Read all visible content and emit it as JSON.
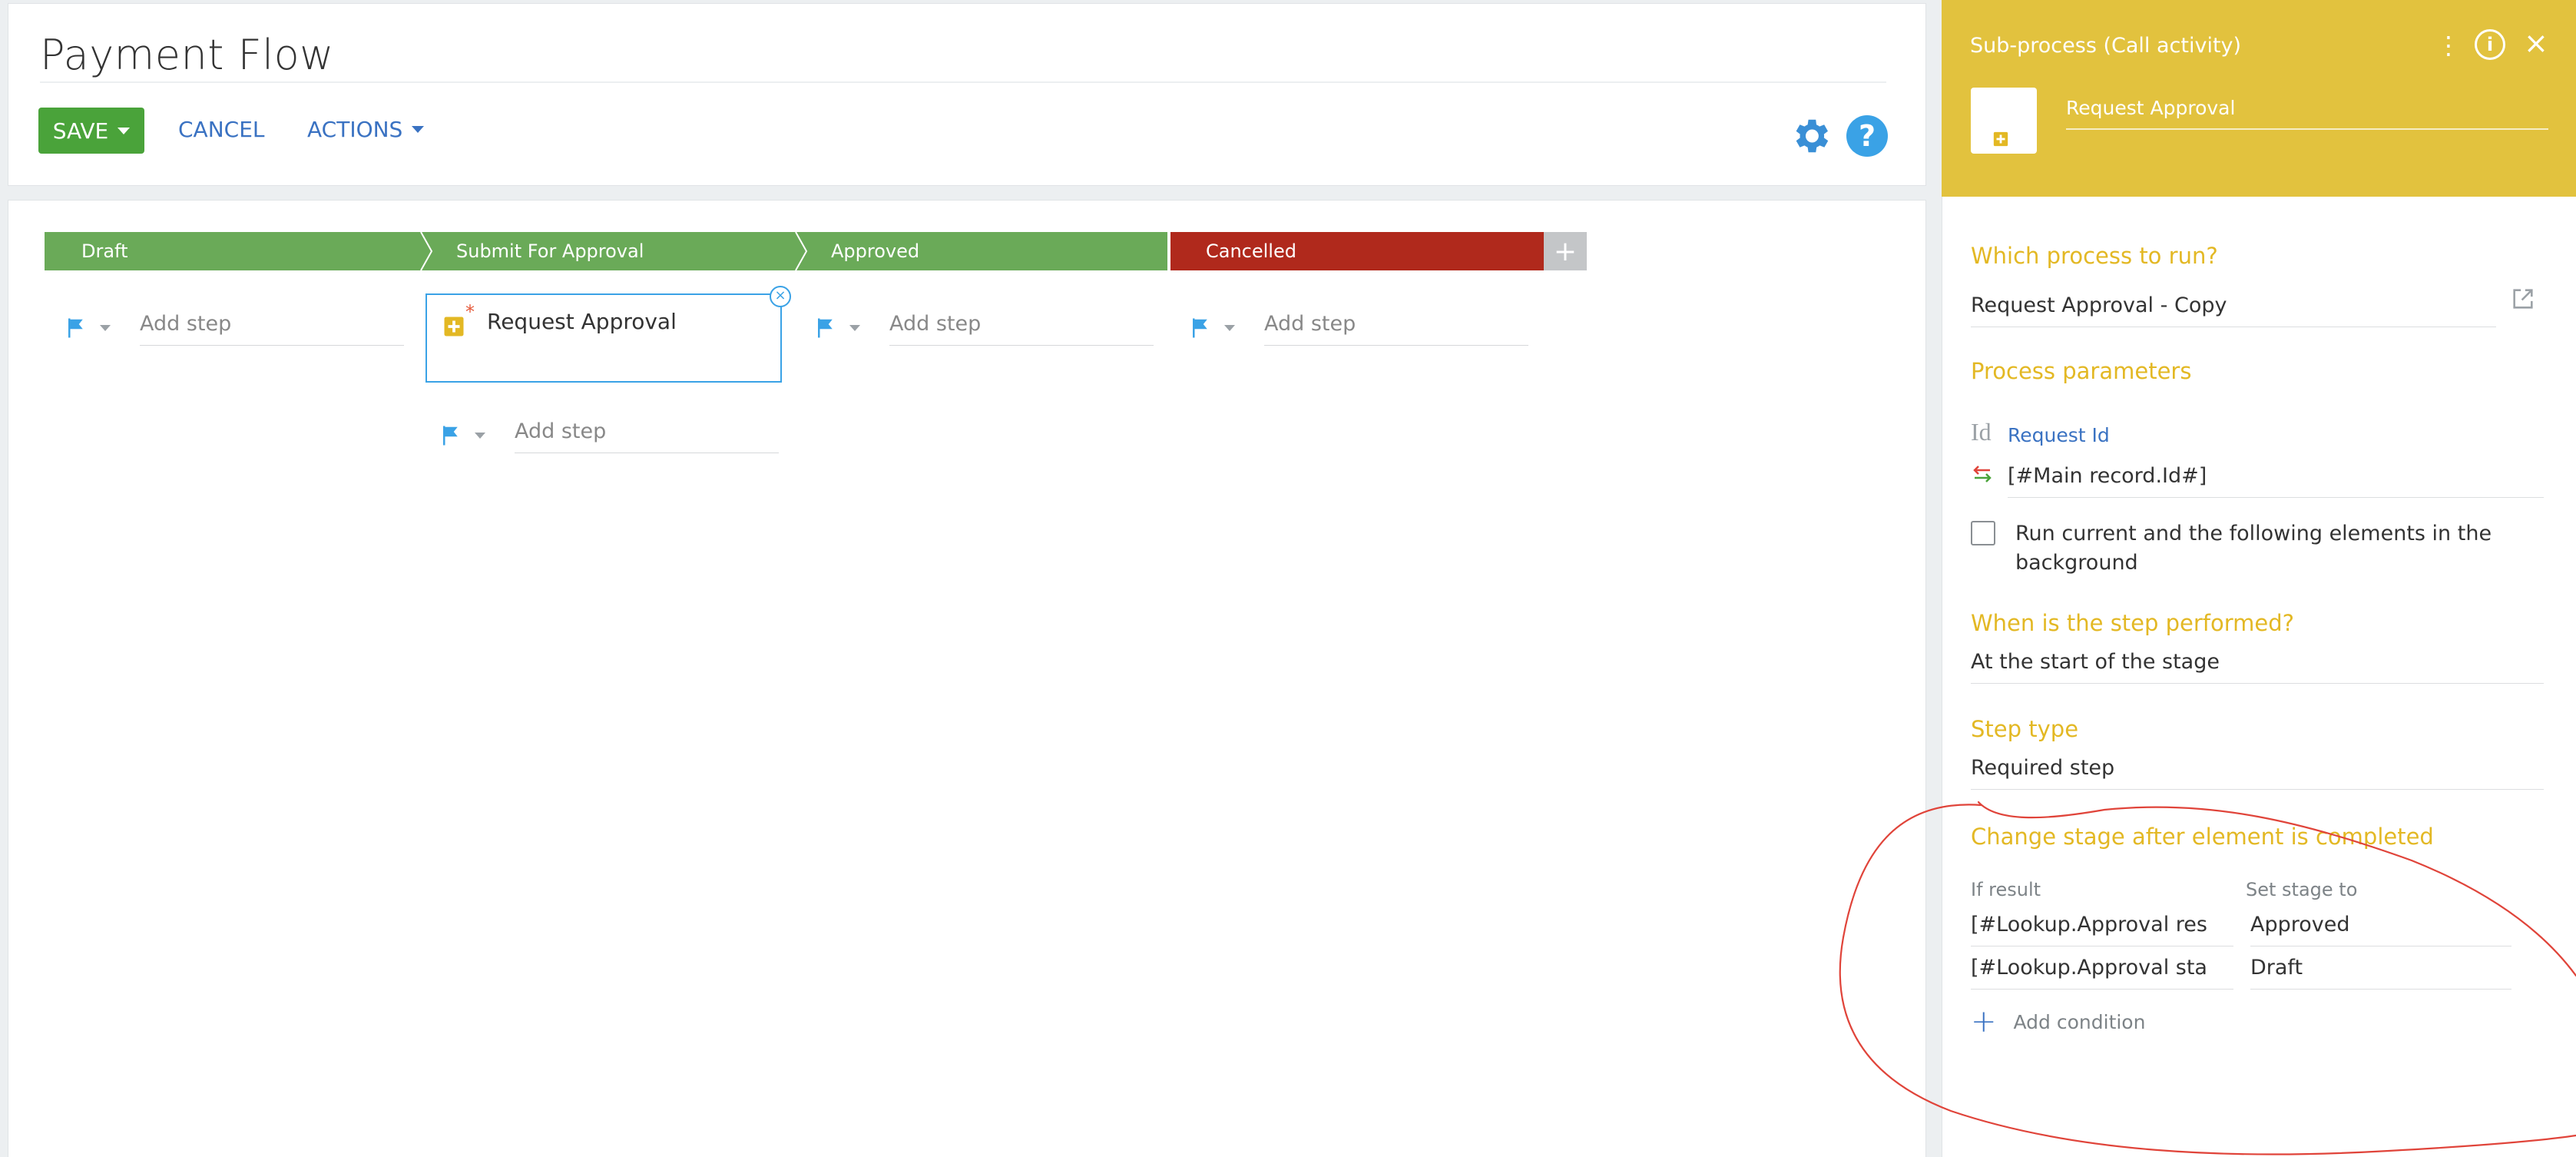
{
  "header": {
    "title": "Payment Flow",
    "save_label": "SAVE",
    "cancel_label": "CANCEL",
    "actions_label": "ACTIONS",
    "help_glyph": "?"
  },
  "stages": [
    {
      "label": "Draft",
      "color": "#6aaa58"
    },
    {
      "label": "Submit For Approval",
      "color": "#6aaa58"
    },
    {
      "label": "Approved",
      "color": "#6aaa58"
    },
    {
      "label": "Cancelled",
      "color": "#b0291c"
    }
  ],
  "stage_add_glyph": "+",
  "columns": {
    "add_step_label": "Add step",
    "step_card": {
      "label": "Request Approval",
      "required_marker": "*"
    }
  },
  "panel": {
    "header_title": "Sub-process (Call activity)",
    "element_name": "Request Approval",
    "info_glyph": "i",
    "process_section": "Which process to run?",
    "process_value": "Request Approval - Copy",
    "params_section": "Process parameters",
    "param": {
      "type_glyph": "Id",
      "name": "Request Id",
      "value": "[#Main record.Id#]"
    },
    "background_label": "Run current and the following elements in the background",
    "when_section": "When is the step performed?",
    "when_value": "At the start of the stage",
    "step_type_section": "Step type",
    "step_type_value": "Required step",
    "change_stage_section": "Change stage after element is completed",
    "if_result_header": "If result",
    "set_stage_header": "Set stage to",
    "conditions": [
      {
        "if_result": "[#Lookup.Approval res",
        "stage": "Approved"
      },
      {
        "if_result": "[#Lookup.Approval sta",
        "stage": "Draft"
      }
    ],
    "add_condition_label": "Add condition"
  },
  "colors": {
    "accent_blue": "#3a72c2",
    "save_green": "#4aa33a",
    "panel_yellow": "#e2c23e",
    "section_yellow": "#e3b824",
    "annotation_red": "#e0443a"
  }
}
